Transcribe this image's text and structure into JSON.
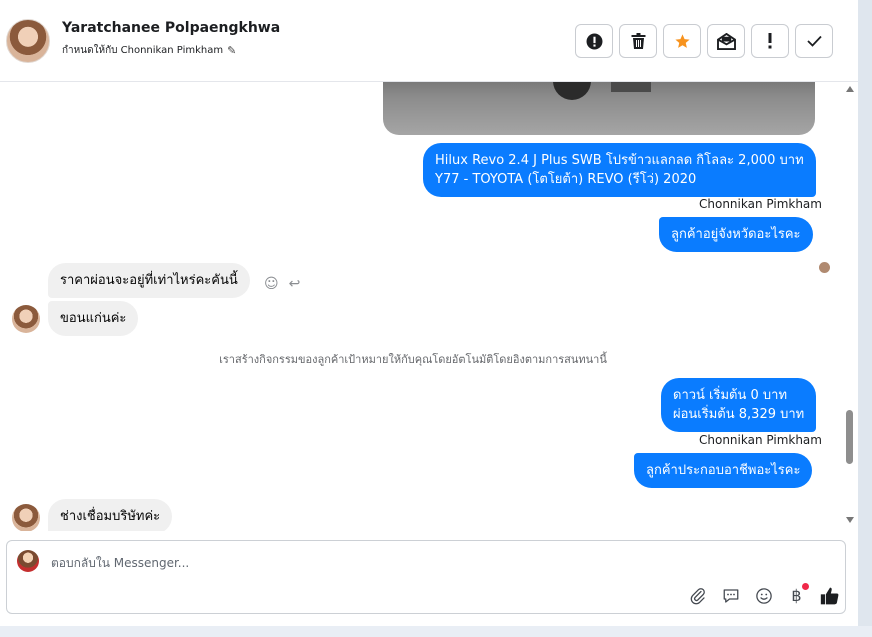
{
  "header": {
    "contact_name": "Yaratchanee Polpaengkhwa",
    "assigned_label": "กำหนดให้กับ Chonnikan Pimkham",
    "actions": [
      {
        "name": "spam-icon"
      },
      {
        "name": "trash-icon"
      },
      {
        "name": "star-icon",
        "color": "#f7931e"
      },
      {
        "name": "mark-unread-icon"
      },
      {
        "name": "follow-up-icon"
      },
      {
        "name": "done-icon"
      }
    ]
  },
  "messages": {
    "out_1": "Hilux Revo 2.4 J Plus SWB โปรข้าวแลกลด กิโลละ 2,000 บาท",
    "out_1b": "Y77 - TOYOTA (โตโยต้า) REVO (รีโว่) 2020",
    "sender_1": "Chonnikan Pimkham",
    "out_2": "ลูกค้าอยู่จังหวัดอะไรคะ",
    "in_1": "ราคาผ่อนจะอยู่ที่เท่าไหร่คะคันนี้",
    "in_2": "ขอนแก่นค่ะ",
    "system_note": "เราสร้างกิจกรรมของลูกค้าเป้าหมายให้กับคุณโดยอัตโนมัติโดยอิงตามการสนทนานี้",
    "out_3a": "ดาวน์ เริ่มต้น 0 บาท",
    "out_3b": "ผ่อนเริ่มต้น 8,329 บาท",
    "sender_2": "Chonnikan Pimkham",
    "out_4": "ลูกค้าประกอบอาชีพอะไรคะ",
    "in_3": "ช่างเชื่อมบริษัทค่ะ"
  },
  "composer": {
    "placeholder": "ตอบกลับใน Messenger...",
    "tools": [
      "attachment-icon",
      "saved-replies-icon",
      "emoji-icon",
      "payment-icon",
      "like-icon"
    ]
  },
  "colors": {
    "outgoing_bubble": "#0a7cff",
    "incoming_bubble": "#f0f0f0",
    "notification_dot": "#f02849"
  }
}
